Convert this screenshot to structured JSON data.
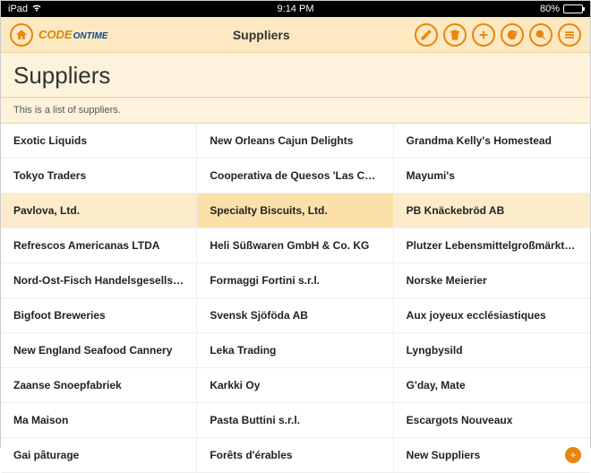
{
  "status": {
    "device": "iPad",
    "time": "9:14 PM",
    "battery": "80%"
  },
  "nav": {
    "title": "Suppliers"
  },
  "page": {
    "title": "Suppliers",
    "description": "This is a list of suppliers."
  },
  "logo": {
    "part1": "CODE",
    "part2": "ONTIME"
  },
  "rows": [
    [
      {
        "label": "Exotic Liquids"
      },
      {
        "label": "New Orleans Cajun Delights"
      },
      {
        "label": "Grandma Kelly's Homestead"
      }
    ],
    [
      {
        "label": "Tokyo Traders"
      },
      {
        "label": "Cooperativa de Quesos 'Las Cabras'"
      },
      {
        "label": "Mayumi's"
      }
    ],
    [
      {
        "label": "Pavlova, Ltd."
      },
      {
        "label": "Specialty Biscuits, Ltd."
      },
      {
        "label": "PB Knäckebröd AB"
      }
    ],
    [
      {
        "label": "Refrescos Americanas LTDA"
      },
      {
        "label": "Heli Süßwaren GmbH & Co. KG"
      },
      {
        "label": "Plutzer Lebensmittelgroßmärkte AG"
      }
    ],
    [
      {
        "label": "Nord-Ost-Fisch Handelsgesellschaft …"
      },
      {
        "label": "Formaggi Fortini s.r.l."
      },
      {
        "label": "Norske Meierier"
      }
    ],
    [
      {
        "label": "Bigfoot Breweries"
      },
      {
        "label": "Svensk Sjöföda AB"
      },
      {
        "label": "Aux joyeux ecclésiastiques"
      }
    ],
    [
      {
        "label": "New England Seafood Cannery"
      },
      {
        "label": "Leka Trading"
      },
      {
        "label": "Lyngbysild"
      }
    ],
    [
      {
        "label": "Zaanse Snoepfabriek"
      },
      {
        "label": "Karkki Oy"
      },
      {
        "label": "G'day, Mate"
      }
    ],
    [
      {
        "label": "Ma Maison"
      },
      {
        "label": "Pasta Buttini s.r.l."
      },
      {
        "label": "Escargots Nouveaux"
      }
    ],
    [
      {
        "label": "Gai pâturage"
      },
      {
        "label": "Forêts d'érables"
      },
      {
        "label": "New Suppliers"
      }
    ]
  ],
  "highlightRow": 2,
  "highlightCol": 1,
  "addAction": {
    "row": 9,
    "col": 2
  },
  "colors": {
    "accent": "#e8860f"
  }
}
